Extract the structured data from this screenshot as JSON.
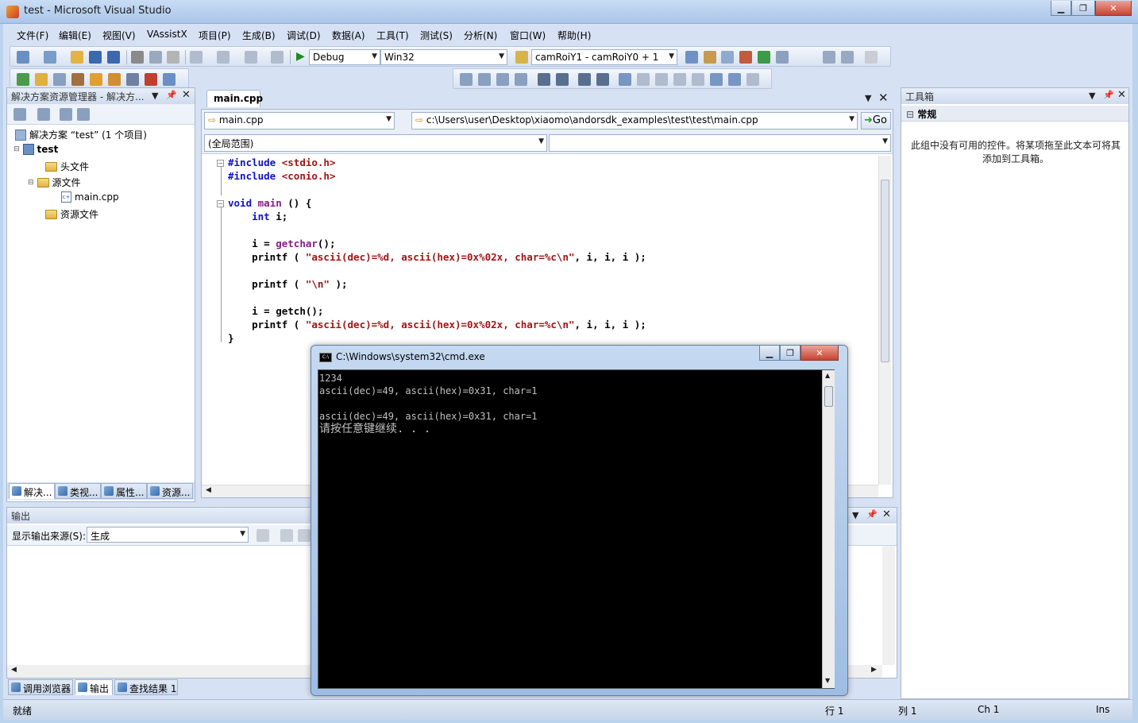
{
  "window": {
    "title": "test - Microsoft Visual Studio"
  },
  "menu": [
    "文件(F)",
    "编辑(E)",
    "视图(V)",
    "VAssistX",
    "项目(P)",
    "生成(B)",
    "调试(D)",
    "数据(A)",
    "工具(T)",
    "测试(S)",
    "分析(N)",
    "窗口(W)",
    "帮助(H)"
  ],
  "toolbar": {
    "config": "Debug",
    "platform": "Win32",
    "find": "camRoiY1 - camRoiY0 + 1"
  },
  "solution_explorer": {
    "title": "解决方案资源管理器 - 解决方...",
    "solution": "解决方案 “test” (1 个项目)",
    "project": "test",
    "headers": "头文件",
    "sources": "源文件",
    "file": "main.cpp",
    "resources": "资源文件",
    "tabs": [
      "解决...",
      "类视...",
      "属性...",
      "资源..."
    ]
  },
  "editor": {
    "tab": "main.cpp",
    "file_combo": "main.cpp",
    "path": "c:\\Users\\user\\Desktop\\xiaomo\\andorsdk_examples\\test\\test\\main.cpp",
    "go": "Go",
    "scope": "(全局范围)",
    "lines": {
      "l1a": "#include",
      "l1b": "<stdio.h>",
      "l2a": "#include",
      "l2b": "<conio.h>",
      "l4a": "void",
      "l4b": "main",
      "l4c": "() {",
      "l5a": "int",
      "l5b": "i;",
      "l7a": "i = ",
      "l7b": "getchar",
      "l7c": "();",
      "l8a": "printf ( ",
      "l8b": "\"ascii(dec)=%d, ascii(hex)=0x%02x, char=%c\\n\"",
      "l8c": ", i, i, i );",
      "l10a": "printf ( ",
      "l10b": "\"\\n\"",
      "l10c": " );",
      "l12a": "i = getch();",
      "l13a": "printf ( ",
      "l13b": "\"ascii(dec)=%d, ascii(hex)=0x%02x, char=%c\\n\"",
      "l13c": ", i, i, i );",
      "l14a": "}"
    }
  },
  "toolbox": {
    "title": "工具箱",
    "group": "常规",
    "empty_text": "此组中没有可用的控件。将某项拖至此文本可将其添加到工具箱。"
  },
  "output": {
    "title": "输出",
    "source_label": "显示输出来源(S):",
    "source_value": "生成",
    "tabs": [
      "调用浏览器",
      "输出",
      "查找结果 1"
    ]
  },
  "cmd": {
    "title": "C:\\Windows\\system32\\cmd.exe",
    "lines": [
      "1234",
      "ascii(dec)=49, ascii(hex)=0x31, char=1",
      "",
      "ascii(dec)=49, ascii(hex)=0x31, char=1",
      "请按任意键继续. . ."
    ]
  },
  "status": {
    "ready": "就绪",
    "row": "行 1",
    "col": "列 1",
    "ch": "Ch 1",
    "ins": "Ins"
  }
}
